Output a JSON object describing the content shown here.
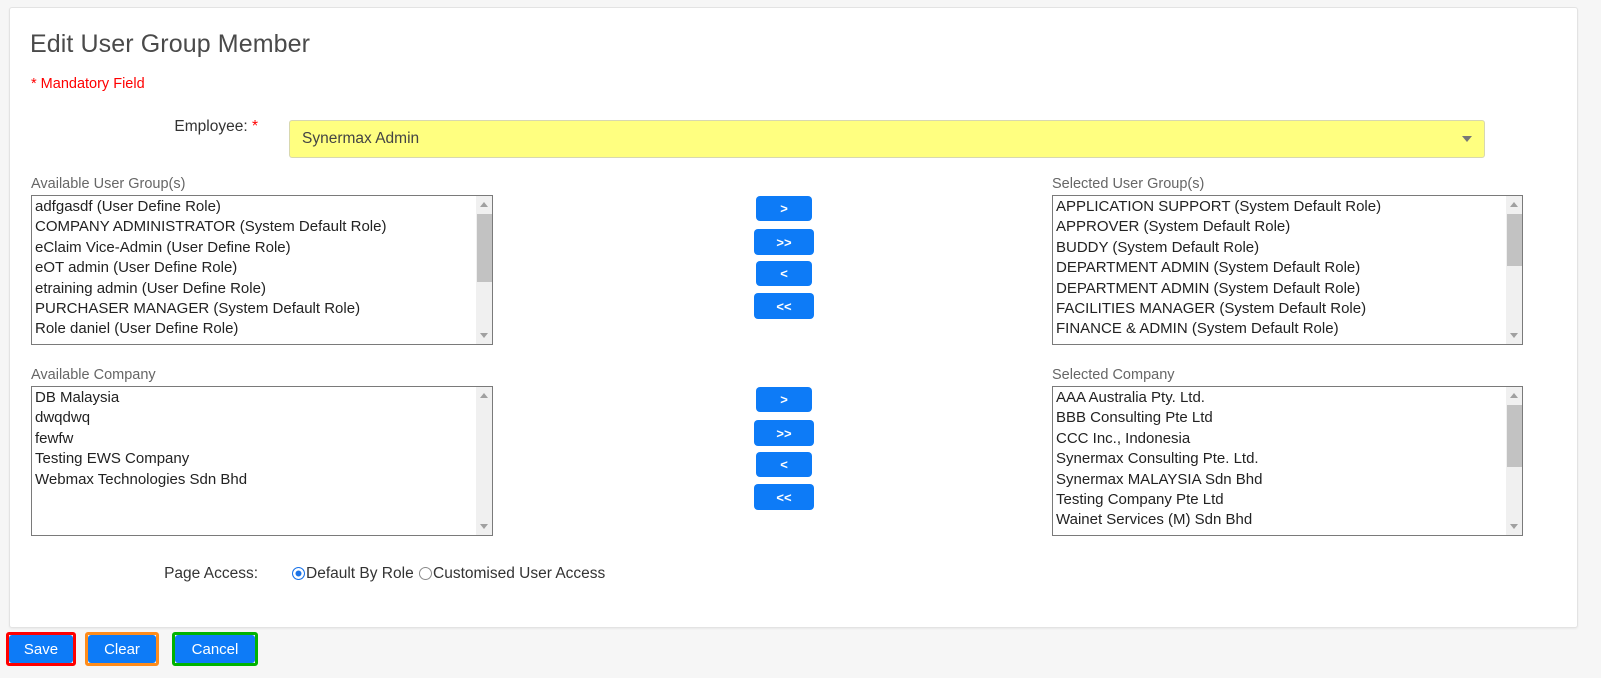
{
  "page": {
    "title": "Edit User Group Member",
    "mandatory_note": "* Mandatory Field"
  },
  "employee": {
    "label": "Employee:",
    "required_star": "*",
    "value": "Synermax Admin",
    "highlight_color": "#ffff80",
    "caret_icon": "chevron-down-icon"
  },
  "user_groups": {
    "available_label": "Available User Group(s)",
    "selected_label": "Selected User Group(s)",
    "available_items": [
      "adfgasdf (User Define Role)",
      "COMPANY ADMINISTRATOR (System Default Role)",
      "eClaim Vice-Admin (User Define Role)",
      "eOT admin (User Define Role)",
      "etraining admin (User Define Role)",
      "PURCHASER MANAGER (System Default Role)",
      "Role daniel (User Define Role)"
    ],
    "selected_items": [
      "APPLICATION SUPPORT (System Default Role)",
      "APPROVER (System Default Role)",
      "BUDDY (System Default Role)",
      "DEPARTMENT ADMIN (System Default Role)",
      "DEPARTMENT ADMIN (System Default Role)",
      "FACILITIES MANAGER (System Default Role)",
      "FINANCE & ADMIN (System Default Role)"
    ],
    "buttons": {
      "move_right": ">",
      "move_all_right": ">>",
      "move_left": "<",
      "move_all_left": "<<"
    }
  },
  "companies": {
    "available_label": "Available Company",
    "selected_label": "Selected Company",
    "available_items": [
      "DB Malaysia",
      "dwqdwq",
      "fewfw",
      "Testing EWS Company",
      "Webmax Technologies Sdn Bhd"
    ],
    "selected_items": [
      "AAA Australia Pty. Ltd.",
      "BBB Consulting Pte Ltd",
      "CCC Inc., Indonesia",
      "Synermax Consulting Pte. Ltd.",
      "Synermax MALAYSIA Sdn Bhd",
      "Testing Company Pte Ltd",
      "Wainet Services (M) Sdn Bhd"
    ],
    "buttons": {
      "move_right": ">",
      "move_all_right": ">>",
      "move_left": "<",
      "move_all_left": "<<"
    }
  },
  "page_access": {
    "label": "Page Access:",
    "options": [
      {
        "label": "Default By Role",
        "selected": true
      },
      {
        "label": "Customised User Access",
        "selected": false
      }
    ]
  },
  "footer": {
    "save_label": "Save",
    "clear_label": "Clear",
    "cancel_label": "Cancel",
    "button_color": "#0d7bf7",
    "save_outline_color": "#ff0000",
    "clear_outline_color": "#ff8c1a",
    "cancel_outline_color": "#00b300"
  }
}
